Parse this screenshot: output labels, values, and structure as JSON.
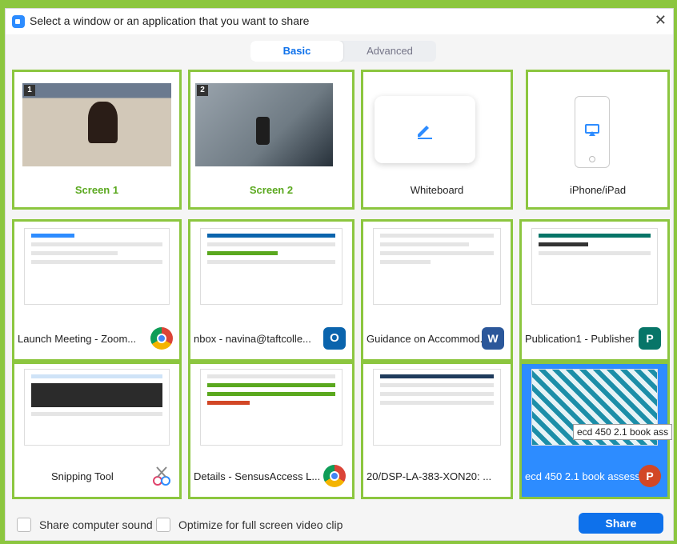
{
  "dialog": {
    "title": "Select a window or an application that you want to share",
    "close_label": "✕",
    "tabs": [
      "Basic",
      "Advanced"
    ]
  },
  "tiles": [
    {
      "label": "Screen 1",
      "badge": "1"
    },
    {
      "label": "Screen 2",
      "badge": "2"
    },
    {
      "label": "Whiteboard"
    },
    {
      "label": "iPhone/iPad"
    },
    {
      "label": "Launch Meeting - Zoom..."
    },
    {
      "label": "nbox - navina@taftcolle..."
    },
    {
      "label": "Guidance on Accommod..."
    },
    {
      "label": "Publication1 - Publisher"
    },
    {
      "label": "Snipping Tool"
    },
    {
      "label": "Details - SensusAccess L..."
    },
    {
      "label": "20/DSP-LA-383-XON20: ..."
    },
    {
      "label": "ecd 450 2.1 book assess..."
    }
  ],
  "tooltip": "ecd 450 2.1 book ass",
  "footer": {
    "share_sound": "Share computer sound",
    "optimize": "Optimize for full screen video clip",
    "share_button": "Share"
  },
  "colors": {
    "accent": "#0e71eb",
    "highlight": "#8cc63f",
    "selected": "#2d8cff"
  }
}
